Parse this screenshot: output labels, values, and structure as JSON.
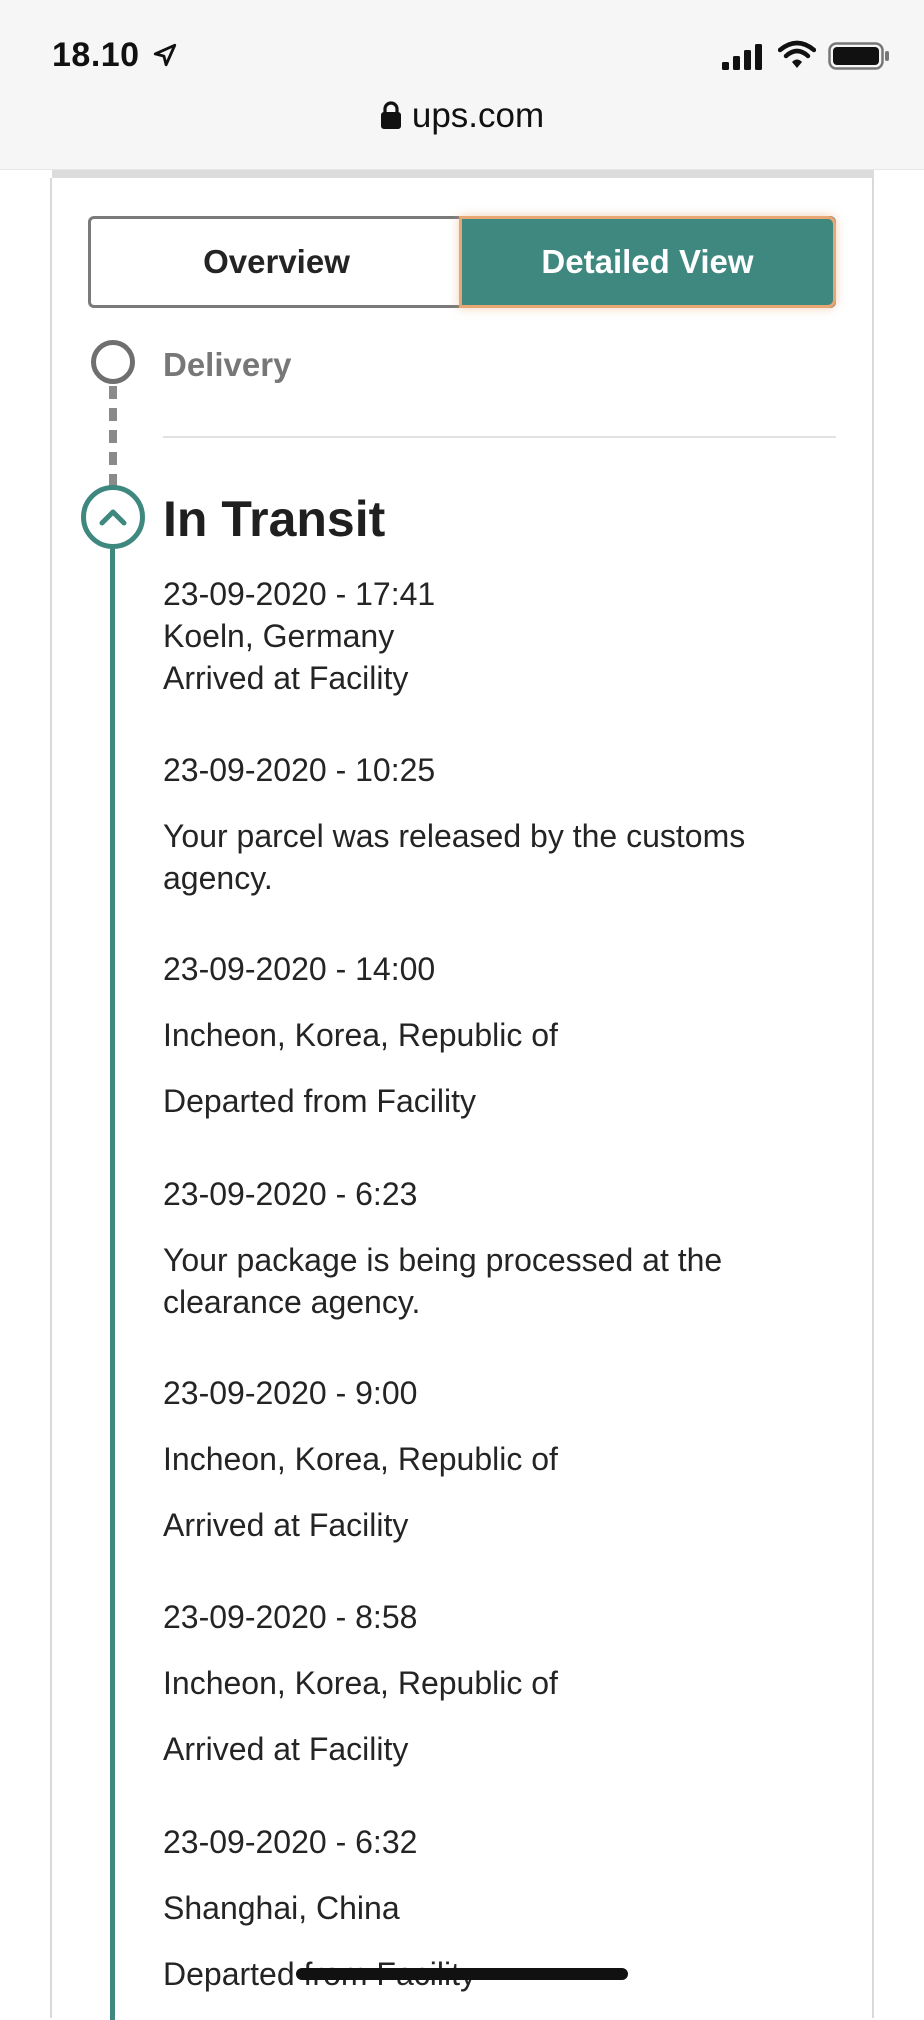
{
  "status_bar": {
    "time": "18.10",
    "location_icon": "location-arrow-icon",
    "signal_icon": "cellular-signal-icon",
    "wifi_icon": "wifi-icon",
    "battery_icon": "battery-icon"
  },
  "url_bar": {
    "lock_icon": "lock-icon",
    "domain": "ups.com"
  },
  "view_toggle": {
    "overview_label": "Overview",
    "detailed_label": "Detailed View",
    "active": "Detailed View"
  },
  "timeline": {
    "delivery_label": "Delivery",
    "section_title": "In Transit",
    "events": [
      {
        "datetime": "23-09-2020 - 17:41",
        "lines": [
          "Koeln, Germany",
          "Arrived at Facility"
        ]
      },
      {
        "datetime": "23-09-2020 - 10:25",
        "lines": [
          "Your parcel was released by the customs",
          "agency."
        ]
      },
      {
        "datetime": "23-09-2020 - 14:00",
        "lines": [
          "Incheon, Korea, Republic of",
          "Departed from Facility"
        ]
      },
      {
        "datetime": "23-09-2020 - 6:23",
        "lines": [
          "Your package is being processed at the",
          "clearance agency."
        ]
      },
      {
        "datetime": "23-09-2020 - 9:00",
        "lines": [
          "Incheon, Korea, Republic of",
          "Arrived at Facility"
        ]
      },
      {
        "datetime": "23-09-2020 - 8:58",
        "lines": [
          "Incheon, Korea, Republic of",
          "Arrived at Facility"
        ]
      },
      {
        "datetime": "23-09-2020 - 6:32",
        "lines": [
          "Shanghai, China",
          "Departed from Facility"
        ]
      }
    ]
  },
  "colors": {
    "accent": "#3e8880",
    "focus_ring": "#e8a673",
    "muted": "#777777"
  }
}
